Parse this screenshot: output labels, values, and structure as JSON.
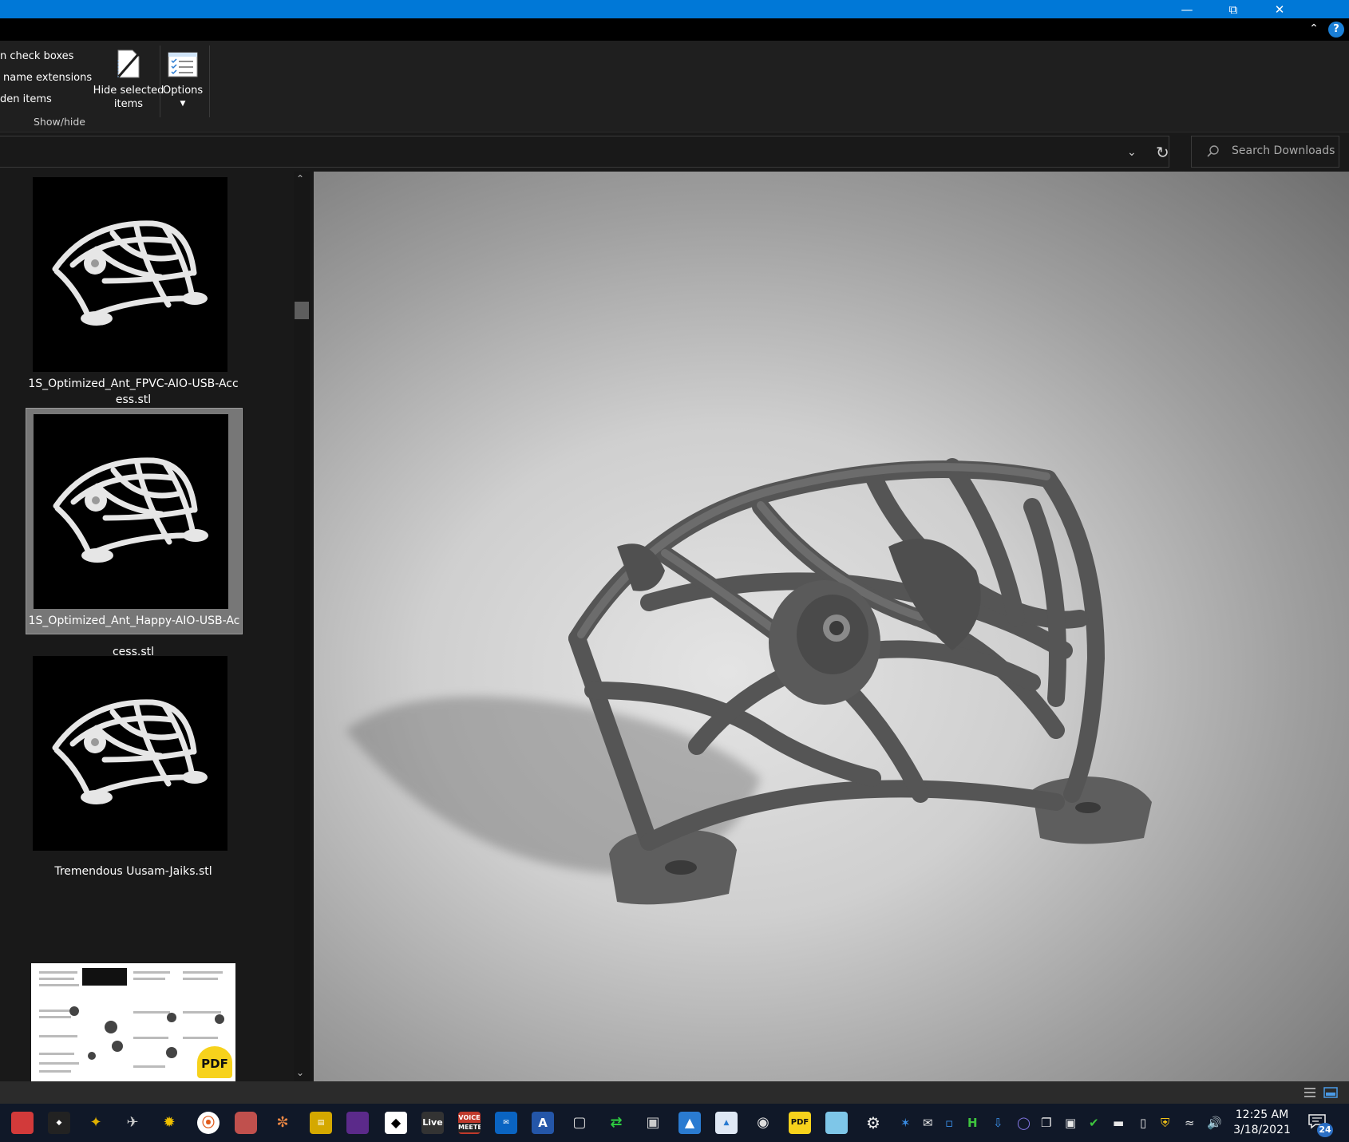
{
  "ribbon": {
    "checkbox_items": [
      "n check boxes",
      "name extensions",
      "den items"
    ],
    "hide_selected_label_line1": "Hide selected",
    "hide_selected_label_line2": "items",
    "options_label": "Options",
    "group_label": "Show/hide"
  },
  "search": {
    "placeholder": "Search Downloads"
  },
  "files": [
    {
      "name_line1": "1S_Optimized_Ant_FPVC-AIO-USB-Acc",
      "name_line2": "ess.stl",
      "selected": false
    },
    {
      "name_line1": "1S_Optimized_Ant_Happy-AIO-USB-Ac",
      "name_line2": "cess.stl",
      "selected": true
    },
    {
      "name_line1": "Tremendous Uusam-Jaiks.stl",
      "name_line2": "",
      "selected": false
    }
  ],
  "pdf_badge": "PDF",
  "taskbar": {
    "live_label": "Live",
    "voicemeeter_top": "VOICE",
    "voicemeeter_bottom": "MEETER",
    "pdf_label": "PDF",
    "time": "12:25 AM",
    "date": "3/18/2021",
    "notification_count": "24"
  },
  "colors": {
    "titlebar": "#0078d7",
    "selection": "#777777",
    "taskbar": "#101828"
  }
}
